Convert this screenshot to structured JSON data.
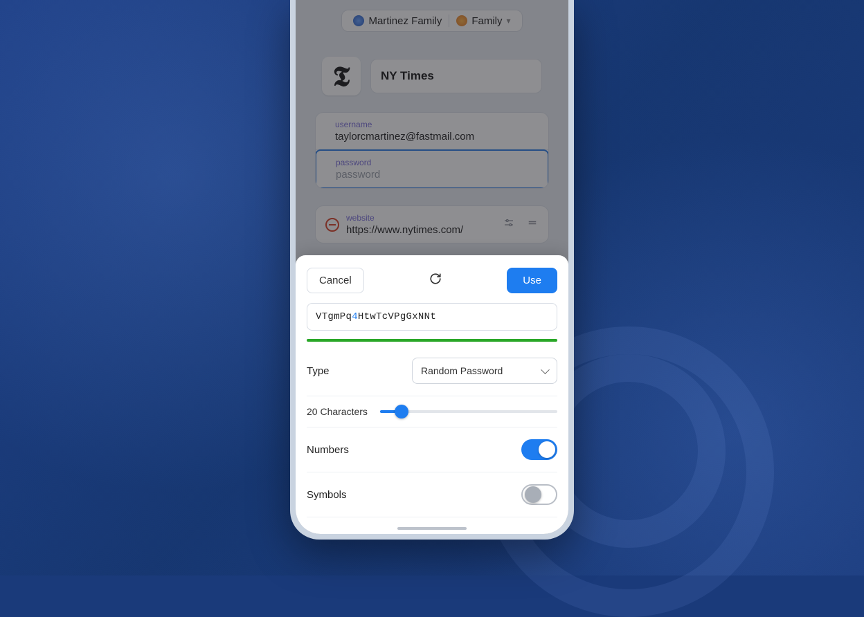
{
  "vaults": {
    "primary": "Martinez Family",
    "secondary": "Family"
  },
  "item": {
    "title": "NY Times",
    "icon_glyph": "𝕿",
    "fields": {
      "username_label": "username",
      "username_value": "taylorcmartinez@fastmail.com",
      "password_label": "password",
      "password_placeholder": "password",
      "website_label": "website",
      "website_value": "https://www.nytimes.com/"
    }
  },
  "generator": {
    "cancel": "Cancel",
    "use": "Use",
    "password_prefix": "VTgmPq",
    "password_digit": "4",
    "password_suffix": "HtwTcVPgGxNNt",
    "type_label": "Type",
    "type_value": "Random Password",
    "length_text": "20 Characters",
    "numbers_label": "Numbers",
    "numbers_on": true,
    "symbols_label": "Symbols",
    "symbols_on": false
  }
}
